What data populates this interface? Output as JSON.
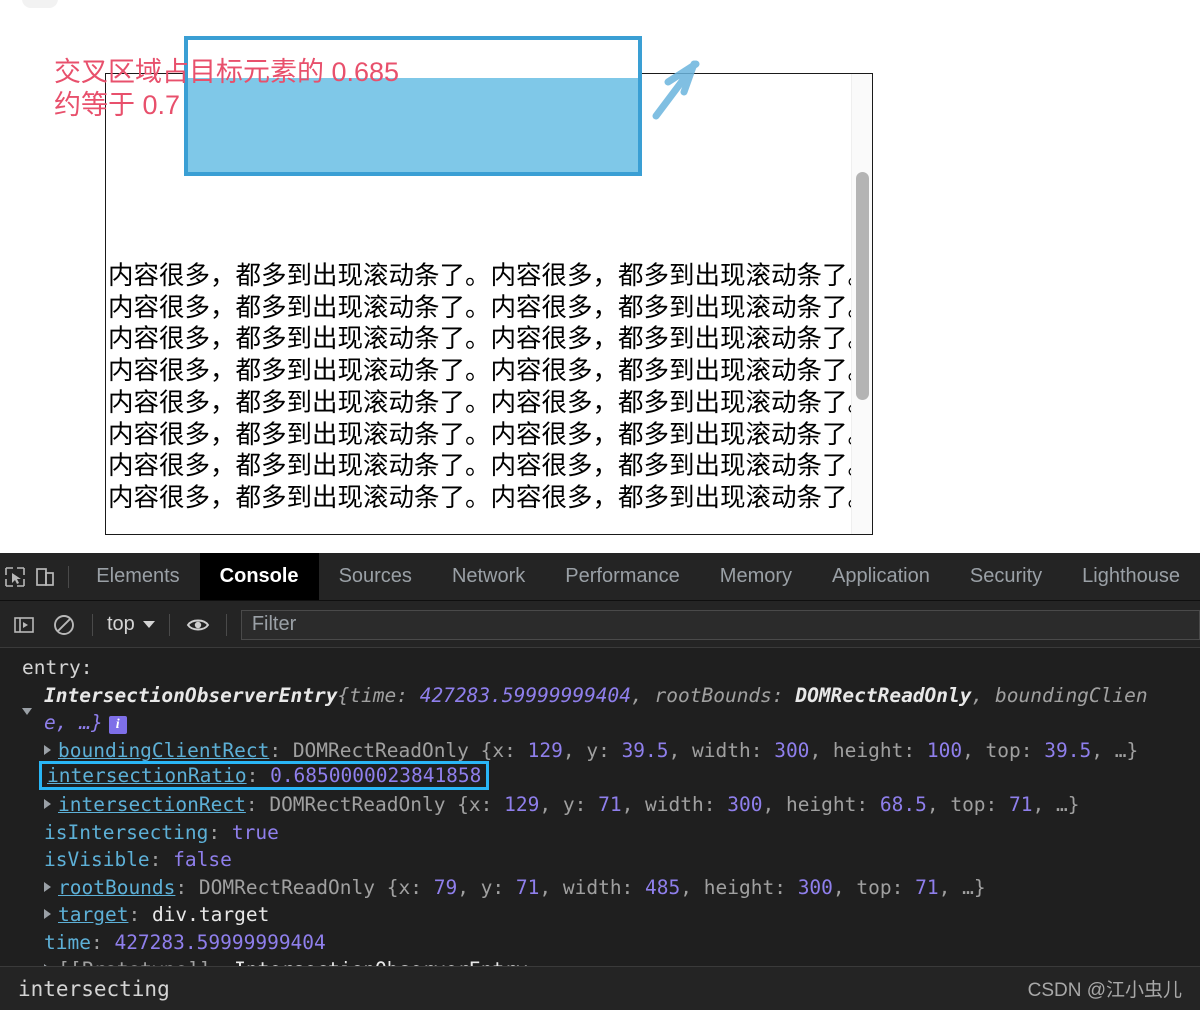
{
  "page": {
    "annotation": {
      "text": "交叉区域占目标元素的 0.685\n约等于 0.7",
      "box_border_color": "#3a9fd4",
      "box_fill_color": "#7fc8e8",
      "text_color": "#e8506c"
    },
    "content_line": "内容很多，都多到出现滚动条了。内容很多，都多到出现滚动条了。",
    "content_line_count": 8,
    "arrow_color": "#6ab4dd"
  },
  "devtools": {
    "tabs": [
      {
        "label": "Elements",
        "active": false
      },
      {
        "label": "Console",
        "active": true
      },
      {
        "label": "Sources",
        "active": false
      },
      {
        "label": "Network",
        "active": false
      },
      {
        "label": "Performance",
        "active": false
      },
      {
        "label": "Memory",
        "active": false
      },
      {
        "label": "Application",
        "active": false
      },
      {
        "label": "Security",
        "active": false
      },
      {
        "label": "Lighthouse",
        "active": false
      }
    ],
    "toolbar": {
      "context_label": "top",
      "filter_placeholder": "Filter"
    },
    "console": {
      "label_line": "entry:",
      "preview": {
        "class_name": "IntersectionObserverEntry",
        "open_brace": "{",
        "time_key": "time",
        "time_value": "427283.59999999404",
        "root_bounds_key": "rootBounds",
        "root_bounds_value": "DOMRectReadOnly",
        "bounding_key": "boundingClien",
        "wrap_tail": "e, …}"
      },
      "properties": [
        {
          "name": "boundingClientRect",
          "type_label": "DOMRectReadOnly",
          "rect": {
            "x": "129",
            "y": "39.5",
            "width": "300",
            "height": "100",
            "top": "39.5"
          },
          "expandable": true
        },
        {
          "name": "intersectionRatio",
          "value": "0.6850000023841858",
          "highlighted": true,
          "highlight_color": "#29b6f6",
          "expandable": false
        },
        {
          "name": "intersectionRect",
          "type_label": "DOMRectReadOnly",
          "rect": {
            "x": "129",
            "y": "71",
            "width": "300",
            "height": "68.5",
            "top": "71"
          },
          "expandable": true
        },
        {
          "name": "isIntersecting",
          "value": "true",
          "expandable": false
        },
        {
          "name": "isVisible",
          "value": "false",
          "expandable": false
        },
        {
          "name": "rootBounds",
          "type_label": "DOMRectReadOnly",
          "rect": {
            "x": "79",
            "y": "71",
            "width": "485",
            "height": "300",
            "top": "71"
          },
          "expandable": true
        },
        {
          "name": "target",
          "value": "div.target",
          "expandable": true
        },
        {
          "name": "time",
          "value": "427283.59999999404",
          "expandable": false
        },
        {
          "name": "[[Prototype]]",
          "value": "IntersectionObserverEntry",
          "expandable": true
        }
      ]
    },
    "statusbar": {
      "message": "intersecting",
      "watermark": "CSDN @江小虫儿"
    }
  }
}
